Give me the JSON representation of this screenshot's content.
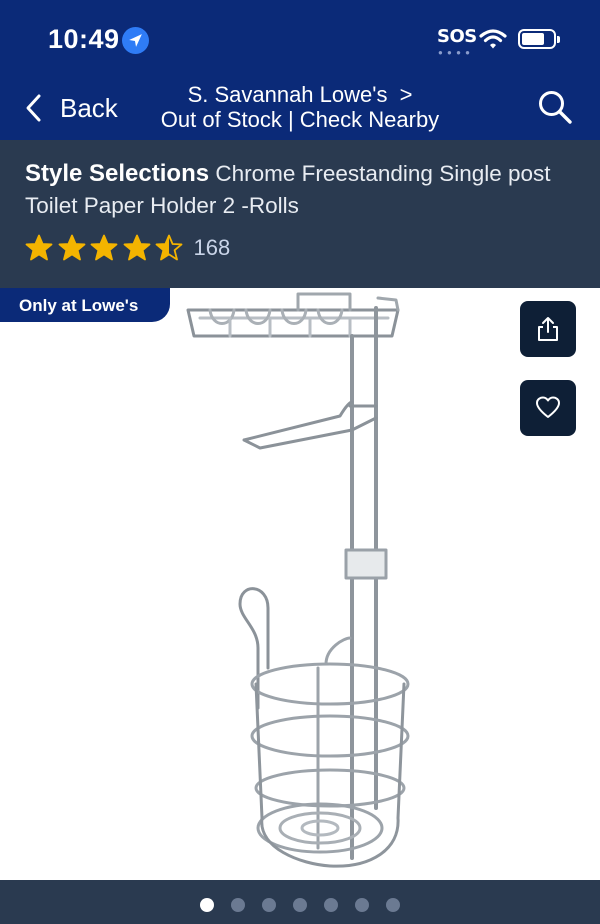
{
  "status_bar": {
    "time": "10:49",
    "sos": "SOS",
    "icons": [
      "location-arrow-icon",
      "wifi-icon",
      "battery-icon"
    ]
  },
  "nav": {
    "back_label": "Back",
    "store_name": "S. Savannah Lowe's",
    "store_chevron": ">",
    "store_status": "Out of Stock | Check Nearby",
    "search_icon": "search-icon"
  },
  "product": {
    "brand": "Style Selections",
    "name": "Chrome Freestanding Single post Toilet Paper Holder 2 -Rolls",
    "rating": 4.5,
    "rating_max": 5,
    "review_count": "168",
    "badge": "Only at Lowe's",
    "share_icon": "share-icon",
    "favorite_icon": "heart-icon"
  },
  "gallery": {
    "image_count": 7,
    "active_index": 0
  },
  "colors": {
    "nav_blue": "#0b2a78",
    "header_slate": "#2a3a50",
    "star_gold": "#f4b400",
    "action_dark": "#0e1f36"
  }
}
